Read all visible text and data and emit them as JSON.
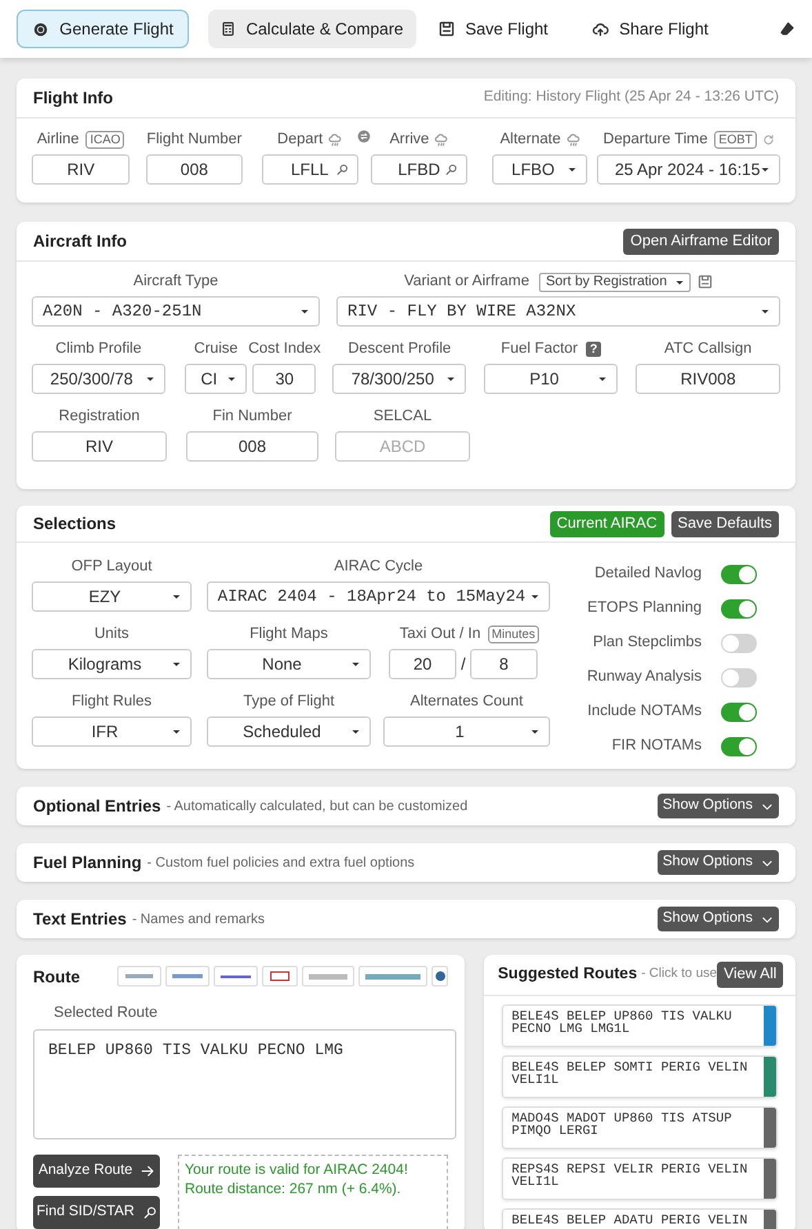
{
  "toolbar": {
    "buttons": [
      {
        "label": "Generate Flight",
        "kind": "primary"
      },
      {
        "label": "Calculate & Compare",
        "kind": "secondary"
      },
      {
        "label": "Save Flight",
        "kind": "plain"
      },
      {
        "label": "Share Flight",
        "kind": "plain"
      }
    ]
  },
  "flight_info": {
    "title": "Flight Info",
    "note": "Editing: History Flight (25 Apr 24 - 13:26 UTC)",
    "fields": [
      {
        "label": "Airline",
        "tag": "ICAO",
        "kind": "text",
        "value": "RIV"
      },
      {
        "label": "Flight Number",
        "kind": "text",
        "value": "008"
      },
      {
        "label": "Depart",
        "kind": "search",
        "value": "LFLL"
      },
      {
        "label": "Arrive",
        "kind": "search",
        "value": "LFBD"
      },
      {
        "label": "Alternate",
        "kind": "select",
        "value": "LFBO"
      },
      {
        "label": "Departure Time",
        "tag": "EOBT",
        "kind": "select",
        "value": "25 Apr 2024 - 16:15"
      }
    ]
  },
  "aircraft_info": {
    "title": "Aircraft Info",
    "button": "Open Airframe Editor",
    "aircraft_type": {
      "label": "Aircraft Type",
      "kind": "select",
      "value": "A20N - A320-251N"
    },
    "airframe": {
      "label": "Variant or Airframe",
      "kind": "select",
      "value": "RIV - FLY BY WIRE A32NX",
      "sort": "Sort by Registration"
    },
    "fields": [
      {
        "label": "Climb Profile",
        "kind": "select",
        "value": "250/300/78"
      },
      {
        "label": "Cruise",
        "kind": "select",
        "value": "CI"
      },
      {
        "label": "Cost Index",
        "kind": "text",
        "value": "30"
      },
      {
        "label": "Descent Profile",
        "kind": "select",
        "value": "78/300/250"
      },
      {
        "label": "Fuel Factor",
        "help": "?",
        "kind": "select",
        "value": "P10"
      },
      {
        "label": "ATC Callsign",
        "kind": "text",
        "value": "RIV008"
      },
      {
        "label": "Registration",
        "kind": "text",
        "value": "RIV"
      },
      {
        "label": "Fin Number",
        "kind": "text",
        "value": "008"
      },
      {
        "label": "SELCAL",
        "kind": "text",
        "placeholder": "ABCD"
      }
    ]
  },
  "selections": {
    "title": "Selections",
    "buttons": [
      {
        "label": "Current AIRAC",
        "kind": "success"
      },
      {
        "label": "Save Defaults",
        "kind": "dark"
      }
    ],
    "rows": [
      [
        {
          "label": "OFP Layout",
          "kind": "select",
          "value": "EZY"
        },
        {
          "label": "AIRAC Cycle",
          "kind": "select",
          "value": "AIRAC 2404 - 18Apr24 to 15May24"
        }
      ],
      [
        {
          "label": "Units",
          "kind": "select",
          "value": "Kilograms"
        },
        {
          "label": "Flight Maps",
          "kind": "select",
          "value": "None"
        },
        {
          "label": "Taxi Out / In",
          "tag": "Minutes",
          "kind": "pair",
          "values": [
            "20",
            "8"
          ],
          "separator": "/"
        }
      ],
      [
        {
          "label": "Flight Rules",
          "kind": "select",
          "value": "IFR"
        },
        {
          "label": "Type of Flight",
          "kind": "select",
          "value": "Scheduled"
        },
        {
          "label": "Alternates Count",
          "kind": "select",
          "value": "1"
        }
      ]
    ],
    "toggles": [
      {
        "label": "Detailed Navlog",
        "on": true
      },
      {
        "label": "ETOPS Planning",
        "on": true
      },
      {
        "label": "Plan Stepclimbs",
        "on": false
      },
      {
        "label": "Runway Analysis",
        "on": false
      },
      {
        "label": "Include NOTAMs",
        "on": true
      },
      {
        "label": "FIR NOTAMs",
        "on": true
      }
    ]
  },
  "collapsed_sections": [
    {
      "title": "Optional Entries",
      "subtitle": "- Automatically calculated, but can be customized",
      "button": "Show Options"
    },
    {
      "title": "Fuel Planning",
      "subtitle": "- Custom fuel policies and extra fuel options",
      "button": "Show Options"
    },
    {
      "title": "Text Entries",
      "subtitle": "- Names and remarks",
      "button": "Show Options"
    }
  ],
  "route": {
    "title": "Route",
    "field_label": "Selected Route",
    "value": "BELEP UP860 TIS VALKU PECNO LMG",
    "buttons": [
      {
        "label": "Analyze Route"
      },
      {
        "label": "Find SID/STAR"
      }
    ],
    "messages": [
      "Your route is valid for AIRAC 2404!",
      "Route distance: 267 nm (+ 6.4%)."
    ]
  },
  "suggested_routes": {
    "title": "Suggested Routes",
    "subtitle": "- Click to use",
    "button": "View All",
    "items": [
      {
        "text": "BELE4S BELEP UP860 TIS VALKU PECNO LMG LMG1L",
        "color": "#1e88c8"
      },
      {
        "text": "BELE4S BELEP SOMTI PERIG VELIN VELI1L",
        "color": "#2a8a6e"
      },
      {
        "text": "MADO4S MADOT UP860 TIS ATSUP PIMQO LERGI",
        "color": "#666666"
      },
      {
        "text": "REPS4S REPSI VELIR PERIG VELIN VELI1L",
        "color": "#666666"
      },
      {
        "text": "BELE4S BELEP ADATU PERIG VELIN",
        "color": "#666666"
      }
    ]
  }
}
